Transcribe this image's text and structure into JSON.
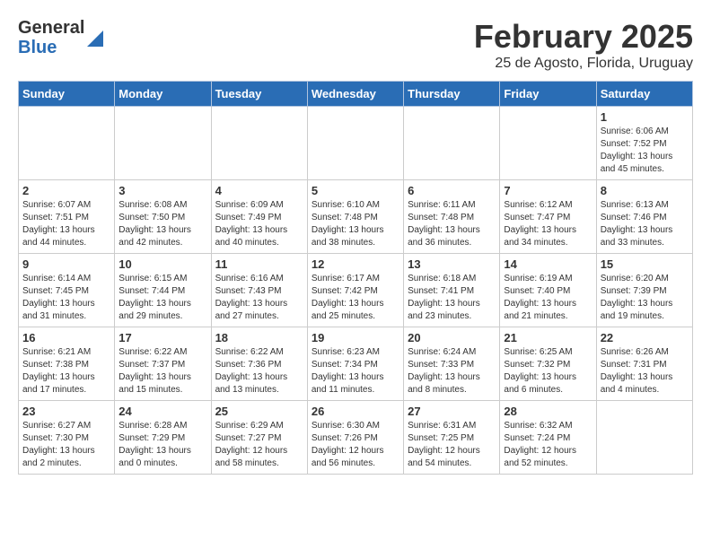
{
  "header": {
    "logo_general": "General",
    "logo_blue": "Blue",
    "month": "February 2025",
    "location": "25 de Agosto, Florida, Uruguay"
  },
  "weekdays": [
    "Sunday",
    "Monday",
    "Tuesday",
    "Wednesday",
    "Thursday",
    "Friday",
    "Saturday"
  ],
  "weeks": [
    [
      {
        "day": "",
        "info": ""
      },
      {
        "day": "",
        "info": ""
      },
      {
        "day": "",
        "info": ""
      },
      {
        "day": "",
        "info": ""
      },
      {
        "day": "",
        "info": ""
      },
      {
        "day": "",
        "info": ""
      },
      {
        "day": "1",
        "info": "Sunrise: 6:06 AM\nSunset: 7:52 PM\nDaylight: 13 hours\nand 45 minutes."
      }
    ],
    [
      {
        "day": "2",
        "info": "Sunrise: 6:07 AM\nSunset: 7:51 PM\nDaylight: 13 hours\nand 44 minutes."
      },
      {
        "day": "3",
        "info": "Sunrise: 6:08 AM\nSunset: 7:50 PM\nDaylight: 13 hours\nand 42 minutes."
      },
      {
        "day": "4",
        "info": "Sunrise: 6:09 AM\nSunset: 7:49 PM\nDaylight: 13 hours\nand 40 minutes."
      },
      {
        "day": "5",
        "info": "Sunrise: 6:10 AM\nSunset: 7:48 PM\nDaylight: 13 hours\nand 38 minutes."
      },
      {
        "day": "6",
        "info": "Sunrise: 6:11 AM\nSunset: 7:48 PM\nDaylight: 13 hours\nand 36 minutes."
      },
      {
        "day": "7",
        "info": "Sunrise: 6:12 AM\nSunset: 7:47 PM\nDaylight: 13 hours\nand 34 minutes."
      },
      {
        "day": "8",
        "info": "Sunrise: 6:13 AM\nSunset: 7:46 PM\nDaylight: 13 hours\nand 33 minutes."
      }
    ],
    [
      {
        "day": "9",
        "info": "Sunrise: 6:14 AM\nSunset: 7:45 PM\nDaylight: 13 hours\nand 31 minutes."
      },
      {
        "day": "10",
        "info": "Sunrise: 6:15 AM\nSunset: 7:44 PM\nDaylight: 13 hours\nand 29 minutes."
      },
      {
        "day": "11",
        "info": "Sunrise: 6:16 AM\nSunset: 7:43 PM\nDaylight: 13 hours\nand 27 minutes."
      },
      {
        "day": "12",
        "info": "Sunrise: 6:17 AM\nSunset: 7:42 PM\nDaylight: 13 hours\nand 25 minutes."
      },
      {
        "day": "13",
        "info": "Sunrise: 6:18 AM\nSunset: 7:41 PM\nDaylight: 13 hours\nand 23 minutes."
      },
      {
        "day": "14",
        "info": "Sunrise: 6:19 AM\nSunset: 7:40 PM\nDaylight: 13 hours\nand 21 minutes."
      },
      {
        "day": "15",
        "info": "Sunrise: 6:20 AM\nSunset: 7:39 PM\nDaylight: 13 hours\nand 19 minutes."
      }
    ],
    [
      {
        "day": "16",
        "info": "Sunrise: 6:21 AM\nSunset: 7:38 PM\nDaylight: 13 hours\nand 17 minutes."
      },
      {
        "day": "17",
        "info": "Sunrise: 6:22 AM\nSunset: 7:37 PM\nDaylight: 13 hours\nand 15 minutes."
      },
      {
        "day": "18",
        "info": "Sunrise: 6:22 AM\nSunset: 7:36 PM\nDaylight: 13 hours\nand 13 minutes."
      },
      {
        "day": "19",
        "info": "Sunrise: 6:23 AM\nSunset: 7:34 PM\nDaylight: 13 hours\nand 11 minutes."
      },
      {
        "day": "20",
        "info": "Sunrise: 6:24 AM\nSunset: 7:33 PM\nDaylight: 13 hours\nand 8 minutes."
      },
      {
        "day": "21",
        "info": "Sunrise: 6:25 AM\nSunset: 7:32 PM\nDaylight: 13 hours\nand 6 minutes."
      },
      {
        "day": "22",
        "info": "Sunrise: 6:26 AM\nSunset: 7:31 PM\nDaylight: 13 hours\nand 4 minutes."
      }
    ],
    [
      {
        "day": "23",
        "info": "Sunrise: 6:27 AM\nSunset: 7:30 PM\nDaylight: 13 hours\nand 2 minutes."
      },
      {
        "day": "24",
        "info": "Sunrise: 6:28 AM\nSunset: 7:29 PM\nDaylight: 13 hours\nand 0 minutes."
      },
      {
        "day": "25",
        "info": "Sunrise: 6:29 AM\nSunset: 7:27 PM\nDaylight: 12 hours\nand 58 minutes."
      },
      {
        "day": "26",
        "info": "Sunrise: 6:30 AM\nSunset: 7:26 PM\nDaylight: 12 hours\nand 56 minutes."
      },
      {
        "day": "27",
        "info": "Sunrise: 6:31 AM\nSunset: 7:25 PM\nDaylight: 12 hours\nand 54 minutes."
      },
      {
        "day": "28",
        "info": "Sunrise: 6:32 AM\nSunset: 7:24 PM\nDaylight: 12 hours\nand 52 minutes."
      },
      {
        "day": "",
        "info": ""
      }
    ]
  ]
}
